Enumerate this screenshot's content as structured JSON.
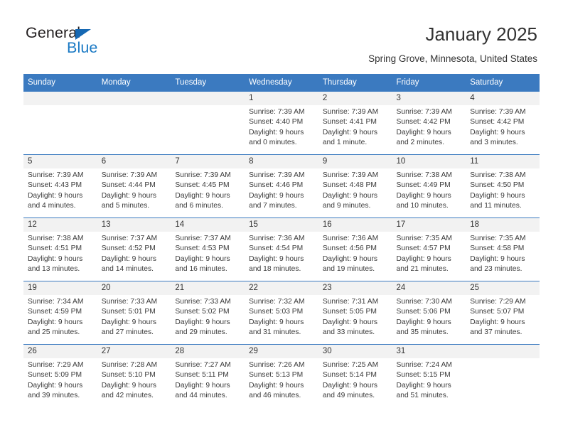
{
  "brand": {
    "name_part1": "General",
    "name_part2": "Blue",
    "triangle_icon": "triangle-icon",
    "color_dark": "#231f20",
    "color_blue": "#1a79c4"
  },
  "header": {
    "title": "January 2025",
    "subtitle": "Spring Grove, Minnesota, United States"
  },
  "theme": {
    "header_blue": "#3b7ac0",
    "daynum_band": "#f2f2f2",
    "text": "#333333"
  },
  "weekday_headers": [
    "Sunday",
    "Monday",
    "Tuesday",
    "Wednesday",
    "Thursday",
    "Friday",
    "Saturday"
  ],
  "labels": {
    "sunrise_prefix": "Sunrise:",
    "sunset_prefix": "Sunset:",
    "daylight_prefix": "Daylight:"
  },
  "weeks": [
    [
      {
        "day": "",
        "line1": "",
        "line2": "",
        "line3": "",
        "line4": "",
        "empty": true
      },
      {
        "day": "",
        "line1": "",
        "line2": "",
        "line3": "",
        "line4": "",
        "empty": true
      },
      {
        "day": "",
        "line1": "",
        "line2": "",
        "line3": "",
        "line4": "",
        "empty": true
      },
      {
        "day": "1",
        "line1": "Sunrise: 7:39 AM",
        "line2": "Sunset: 4:40 PM",
        "line3": "Daylight: 9 hours",
        "line4": "and 0 minutes.",
        "empty": false
      },
      {
        "day": "2",
        "line1": "Sunrise: 7:39 AM",
        "line2": "Sunset: 4:41 PM",
        "line3": "Daylight: 9 hours",
        "line4": "and 1 minute.",
        "empty": false
      },
      {
        "day": "3",
        "line1": "Sunrise: 7:39 AM",
        "line2": "Sunset: 4:42 PM",
        "line3": "Daylight: 9 hours",
        "line4": "and 2 minutes.",
        "empty": false
      },
      {
        "day": "4",
        "line1": "Sunrise: 7:39 AM",
        "line2": "Sunset: 4:42 PM",
        "line3": "Daylight: 9 hours",
        "line4": "and 3 minutes.",
        "empty": false
      }
    ],
    [
      {
        "day": "5",
        "line1": "Sunrise: 7:39 AM",
        "line2": "Sunset: 4:43 PM",
        "line3": "Daylight: 9 hours",
        "line4": "and 4 minutes.",
        "empty": false
      },
      {
        "day": "6",
        "line1": "Sunrise: 7:39 AM",
        "line2": "Sunset: 4:44 PM",
        "line3": "Daylight: 9 hours",
        "line4": "and 5 minutes.",
        "empty": false
      },
      {
        "day": "7",
        "line1": "Sunrise: 7:39 AM",
        "line2": "Sunset: 4:45 PM",
        "line3": "Daylight: 9 hours",
        "line4": "and 6 minutes.",
        "empty": false
      },
      {
        "day": "8",
        "line1": "Sunrise: 7:39 AM",
        "line2": "Sunset: 4:46 PM",
        "line3": "Daylight: 9 hours",
        "line4": "and 7 minutes.",
        "empty": false
      },
      {
        "day": "9",
        "line1": "Sunrise: 7:39 AM",
        "line2": "Sunset: 4:48 PM",
        "line3": "Daylight: 9 hours",
        "line4": "and 9 minutes.",
        "empty": false
      },
      {
        "day": "10",
        "line1": "Sunrise: 7:38 AM",
        "line2": "Sunset: 4:49 PM",
        "line3": "Daylight: 9 hours",
        "line4": "and 10 minutes.",
        "empty": false
      },
      {
        "day": "11",
        "line1": "Sunrise: 7:38 AM",
        "line2": "Sunset: 4:50 PM",
        "line3": "Daylight: 9 hours",
        "line4": "and 11 minutes.",
        "empty": false
      }
    ],
    [
      {
        "day": "12",
        "line1": "Sunrise: 7:38 AM",
        "line2": "Sunset: 4:51 PM",
        "line3": "Daylight: 9 hours",
        "line4": "and 13 minutes.",
        "empty": false
      },
      {
        "day": "13",
        "line1": "Sunrise: 7:37 AM",
        "line2": "Sunset: 4:52 PM",
        "line3": "Daylight: 9 hours",
        "line4": "and 14 minutes.",
        "empty": false
      },
      {
        "day": "14",
        "line1": "Sunrise: 7:37 AM",
        "line2": "Sunset: 4:53 PM",
        "line3": "Daylight: 9 hours",
        "line4": "and 16 minutes.",
        "empty": false
      },
      {
        "day": "15",
        "line1": "Sunrise: 7:36 AM",
        "line2": "Sunset: 4:54 PM",
        "line3": "Daylight: 9 hours",
        "line4": "and 18 minutes.",
        "empty": false
      },
      {
        "day": "16",
        "line1": "Sunrise: 7:36 AM",
        "line2": "Sunset: 4:56 PM",
        "line3": "Daylight: 9 hours",
        "line4": "and 19 minutes.",
        "empty": false
      },
      {
        "day": "17",
        "line1": "Sunrise: 7:35 AM",
        "line2": "Sunset: 4:57 PM",
        "line3": "Daylight: 9 hours",
        "line4": "and 21 minutes.",
        "empty": false
      },
      {
        "day": "18",
        "line1": "Sunrise: 7:35 AM",
        "line2": "Sunset: 4:58 PM",
        "line3": "Daylight: 9 hours",
        "line4": "and 23 minutes.",
        "empty": false
      }
    ],
    [
      {
        "day": "19",
        "line1": "Sunrise: 7:34 AM",
        "line2": "Sunset: 4:59 PM",
        "line3": "Daylight: 9 hours",
        "line4": "and 25 minutes.",
        "empty": false
      },
      {
        "day": "20",
        "line1": "Sunrise: 7:33 AM",
        "line2": "Sunset: 5:01 PM",
        "line3": "Daylight: 9 hours",
        "line4": "and 27 minutes.",
        "empty": false
      },
      {
        "day": "21",
        "line1": "Sunrise: 7:33 AM",
        "line2": "Sunset: 5:02 PM",
        "line3": "Daylight: 9 hours",
        "line4": "and 29 minutes.",
        "empty": false
      },
      {
        "day": "22",
        "line1": "Sunrise: 7:32 AM",
        "line2": "Sunset: 5:03 PM",
        "line3": "Daylight: 9 hours",
        "line4": "and 31 minutes.",
        "empty": false
      },
      {
        "day": "23",
        "line1": "Sunrise: 7:31 AM",
        "line2": "Sunset: 5:05 PM",
        "line3": "Daylight: 9 hours",
        "line4": "and 33 minutes.",
        "empty": false
      },
      {
        "day": "24",
        "line1": "Sunrise: 7:30 AM",
        "line2": "Sunset: 5:06 PM",
        "line3": "Daylight: 9 hours",
        "line4": "and 35 minutes.",
        "empty": false
      },
      {
        "day": "25",
        "line1": "Sunrise: 7:29 AM",
        "line2": "Sunset: 5:07 PM",
        "line3": "Daylight: 9 hours",
        "line4": "and 37 minutes.",
        "empty": false
      }
    ],
    [
      {
        "day": "26",
        "line1": "Sunrise: 7:29 AM",
        "line2": "Sunset: 5:09 PM",
        "line3": "Daylight: 9 hours",
        "line4": "and 39 minutes.",
        "empty": false
      },
      {
        "day": "27",
        "line1": "Sunrise: 7:28 AM",
        "line2": "Sunset: 5:10 PM",
        "line3": "Daylight: 9 hours",
        "line4": "and 42 minutes.",
        "empty": false
      },
      {
        "day": "28",
        "line1": "Sunrise: 7:27 AM",
        "line2": "Sunset: 5:11 PM",
        "line3": "Daylight: 9 hours",
        "line4": "and 44 minutes.",
        "empty": false
      },
      {
        "day": "29",
        "line1": "Sunrise: 7:26 AM",
        "line2": "Sunset: 5:13 PM",
        "line3": "Daylight: 9 hours",
        "line4": "and 46 minutes.",
        "empty": false
      },
      {
        "day": "30",
        "line1": "Sunrise: 7:25 AM",
        "line2": "Sunset: 5:14 PM",
        "line3": "Daylight: 9 hours",
        "line4": "and 49 minutes.",
        "empty": false
      },
      {
        "day": "31",
        "line1": "Sunrise: 7:24 AM",
        "line2": "Sunset: 5:15 PM",
        "line3": "Daylight: 9 hours",
        "line4": "and 51 minutes.",
        "empty": false
      },
      {
        "day": "",
        "line1": "",
        "line2": "",
        "line3": "",
        "line4": "",
        "empty": true
      }
    ]
  ]
}
